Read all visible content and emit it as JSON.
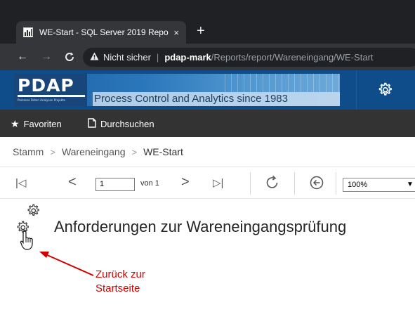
{
  "browser": {
    "tab_title": "WE-Start - SQL Server 2019 Repo",
    "tab_close": "×",
    "new_tab": "+",
    "security_label": "Nicht sicher",
    "url_host": "pdap-mark",
    "url_path": "/Reports/report/Wareneingang/WE-Start"
  },
  "banner": {
    "logo": "PDAP",
    "logo_subtitle": "Prozesse Daten Analysen Projekte",
    "tagline": "Process Control and Analytics since 1983"
  },
  "favorites_bar": {
    "favorites_label": "Favoriten",
    "browse_label": "Durchsuchen"
  },
  "breadcrumb": {
    "items": [
      "Stamm",
      "Wareneingang",
      "WE-Start"
    ]
  },
  "toolbar": {
    "page_value": "1",
    "page_of": "von 1",
    "zoom_value": "100%"
  },
  "report": {
    "title": "Anforderungen zur Wareneingangsprüfung"
  },
  "annotation": {
    "line1": "Zurück zur",
    "line2": "Startseite",
    "color": "#d40000"
  },
  "colors": {
    "tabstrip": "#202124",
    "banner": "#0f4d8a",
    "favbar": "#333333"
  }
}
